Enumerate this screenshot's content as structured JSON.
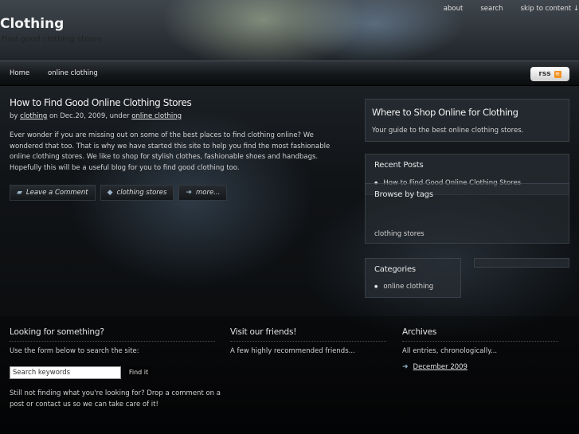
{
  "header": {
    "top_links": [
      "about",
      "search",
      "skip to content ↓"
    ],
    "site_title": "Clothing",
    "tagline": "Find good clothing stores"
  },
  "nav": {
    "items": [
      "Home",
      "online clothing"
    ],
    "rss_label": "rss"
  },
  "post": {
    "title": "How to Find Good Online Clothing Stores",
    "meta_prefix": "by ",
    "author": "clothing",
    "meta_date": " on Dec.20, 2009, under ",
    "category": "online clothing",
    "body": "Ever wonder if you are missing out on some of the best places to find clothing online? We wondered that too. That is why we have started this site to help you find the most fashionable online clothing stores. We like to shop for stylish clothes, fashionable shoes and handbags. Hopefully this will be a useful blog for you to find good clothing too.",
    "actions": [
      {
        "label": "Leave a Comment",
        "icon": "comment-icon"
      },
      {
        "label": "clothing stores",
        "icon": "tag-icon"
      },
      {
        "label": "more...",
        "icon": "arrow-icon"
      }
    ]
  },
  "sidebar": {
    "where_title": "Where to Shop Online for Clothing",
    "where_text": "Your guide to the best online clothing stores.",
    "recent_title": "Recent Posts",
    "recent_items": [
      "How to Find Good Online Clothing Stores"
    ],
    "tags_title": "Browse by tags",
    "tags": [
      "clothing stores"
    ],
    "categories_title": "Categories",
    "categories": [
      "online clothing"
    ]
  },
  "footer": {
    "search_title": "Looking for something?",
    "search_intro": "Use the form below to search the site:",
    "search_placeholder": "Search keywords",
    "search_button": "Find it",
    "search_note": "Still not finding what you're looking for? Drop a comment on a post or contact us so we can take care of it!",
    "friends_title": "Visit our friends!",
    "friends_text": "A few highly recommended friends...",
    "archives_title": "Archives",
    "archives_text": "All entries, chronologically...",
    "archives_items": [
      "December 2009"
    ]
  }
}
